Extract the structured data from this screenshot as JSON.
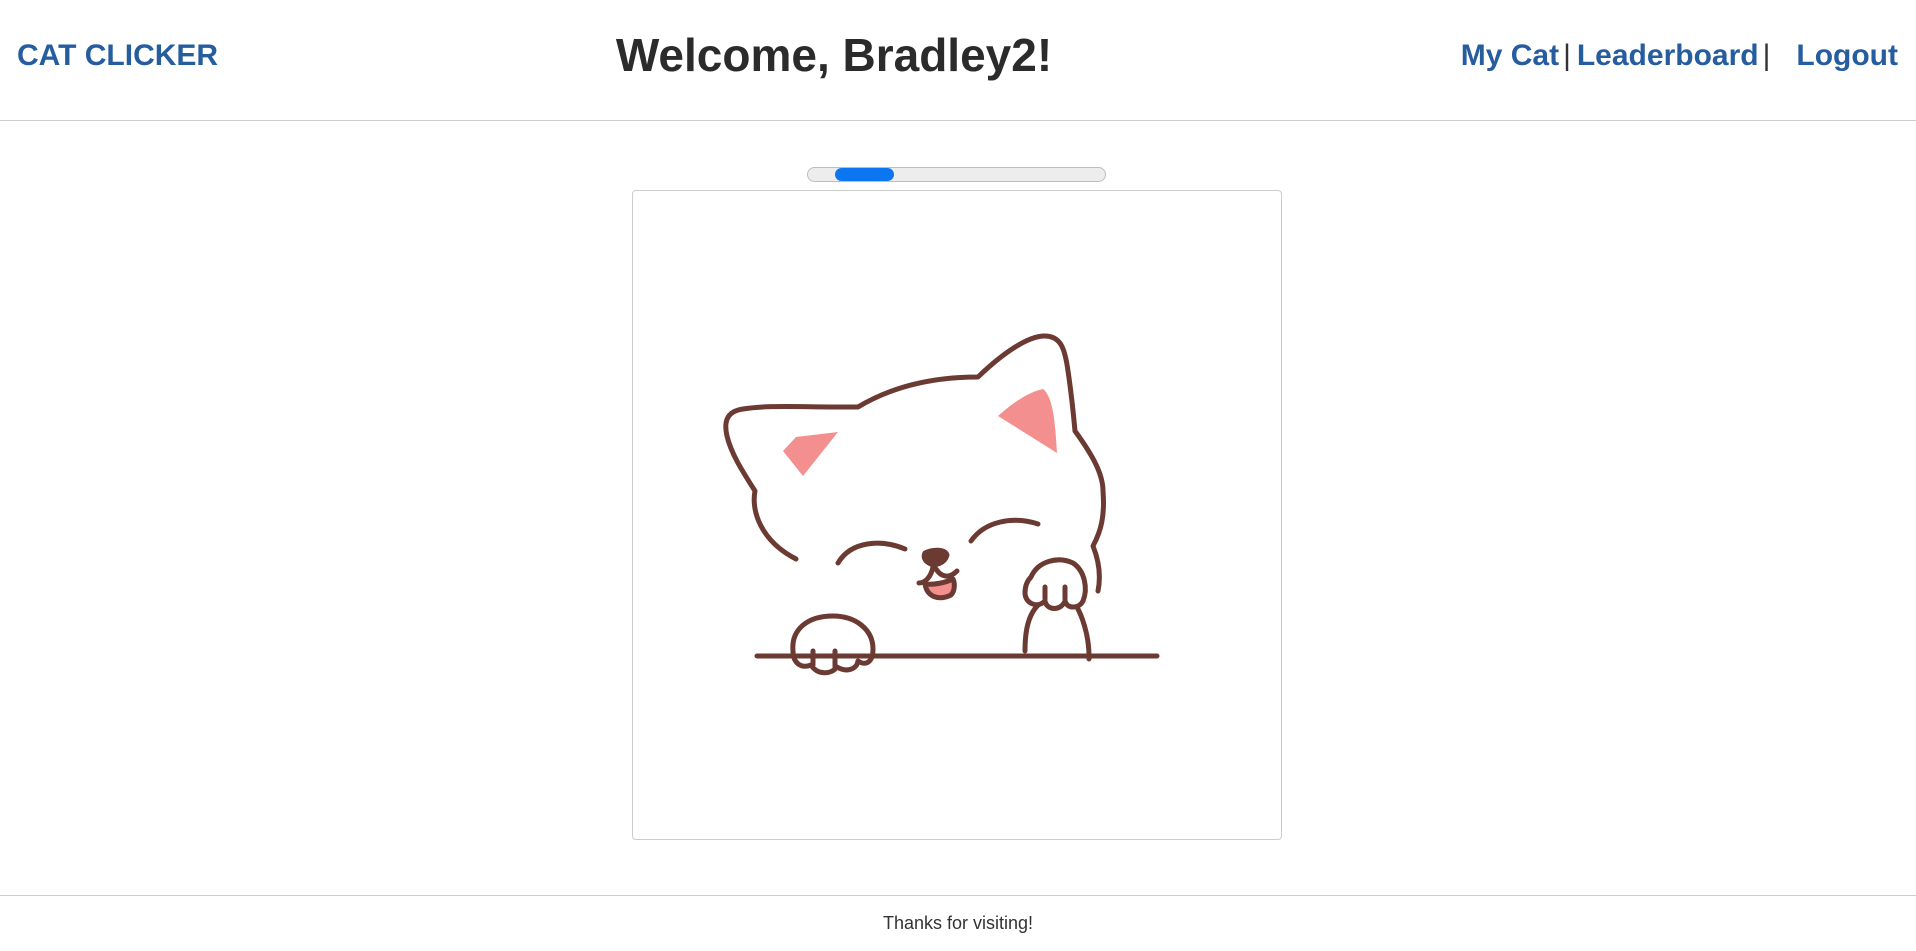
{
  "header": {
    "brand": "CAT CLICKER",
    "welcome": "Welcome, Bradley2!",
    "nav": {
      "my_cat": "My Cat",
      "separator": "|",
      "leaderboard": "Leaderboard",
      "logout": "Logout"
    }
  },
  "progress": {
    "start_fraction": 0.09,
    "end_fraction": 0.29,
    "color": "#0b76f0"
  },
  "cat": {
    "icon": "cat-icon",
    "outline_color": "#6b3a32",
    "ear_color": "#f48f8f"
  },
  "footer": {
    "text": "Thanks for visiting!"
  }
}
